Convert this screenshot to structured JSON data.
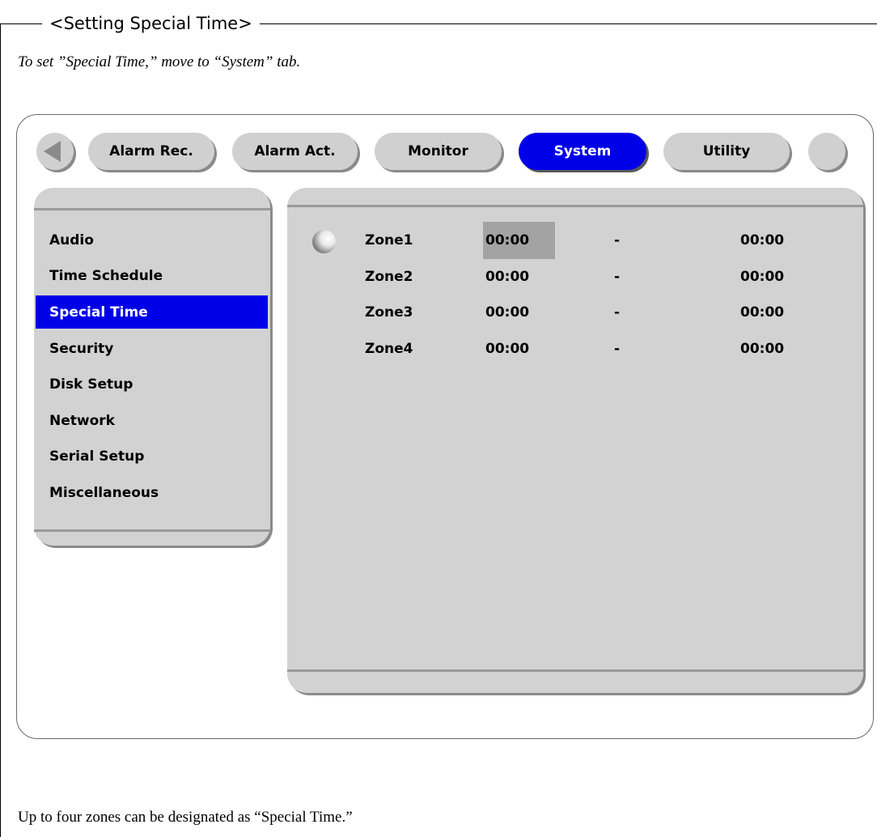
{
  "document": {
    "heading": "<Setting Special Time>",
    "intro": "To set ”Special Time,” move to “System” tab.",
    "note": "Up to four zones can be designated as “Special Time.”"
  },
  "tabs": {
    "prev_icon": "left-arrow-icon",
    "items": [
      {
        "label": "Alarm Rec."
      },
      {
        "label": "Alarm Act."
      },
      {
        "label": "Monitor"
      },
      {
        "label": "System",
        "active": true
      },
      {
        "label": "Utility"
      }
    ],
    "next_icon": "circle-button"
  },
  "sidebar": {
    "items": [
      {
        "label": "Audio"
      },
      {
        "label": "Time Schedule"
      },
      {
        "label": "Special Time",
        "selected": true
      },
      {
        "label": "Security"
      },
      {
        "label": "Disk Setup"
      },
      {
        "label": "Network"
      },
      {
        "label": "Serial Setup"
      },
      {
        "label": "Miscellaneous"
      }
    ]
  },
  "zones": [
    {
      "name": "Zone1",
      "start": "00:00",
      "sep": "-",
      "end": "00:00"
    },
    {
      "name": "Zone2",
      "start": "00:00",
      "sep": "-",
      "end": "00:00"
    },
    {
      "name": "Zone3",
      "start": "00:00",
      "sep": "-",
      "end": "00:00"
    },
    {
      "name": "Zone4",
      "start": "00:00",
      "sep": "-",
      "end": "00:00"
    }
  ],
  "colors": {
    "active_tab": "#0000e8",
    "panel": "#d2d2d2",
    "focus_cell": "#a3a3a3"
  }
}
